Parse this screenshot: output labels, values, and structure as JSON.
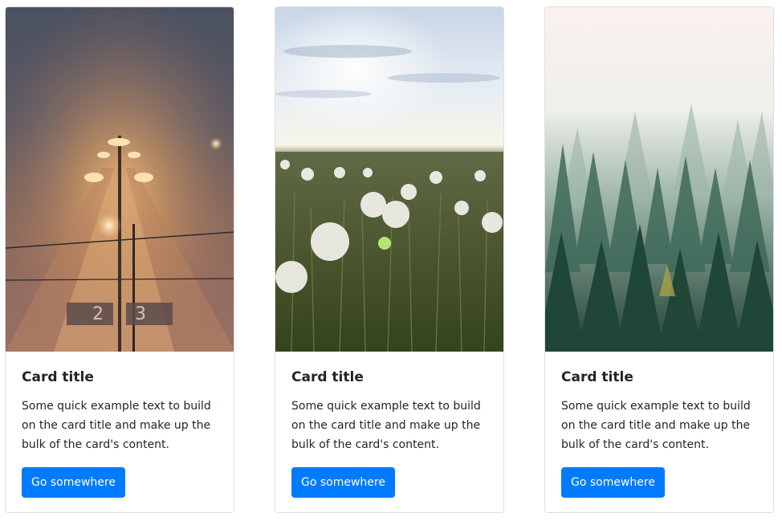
{
  "cards": [
    {
      "image_name": "foggy-station-image",
      "title": "Card title",
      "text": "Some quick example text to build on the card title and make up the bulk of the card's content.",
      "button_label": "Go somewhere",
      "platform_sign_left": "2",
      "platform_sign_right": "3"
    },
    {
      "image_name": "dandelion-field-image",
      "title": "Card title",
      "text": "Some quick example text to build on the card title and make up the bulk of the card's content.",
      "button_label": "Go somewhere"
    },
    {
      "image_name": "misty-forest-image",
      "title": "Card title",
      "text": "Some quick example text to build on the card title and make up the bulk of the card's content.",
      "button_label": "Go somewhere"
    }
  ],
  "colors": {
    "button_bg": "#007bff",
    "button_text": "#ffffff",
    "card_border": "#dfdfdf",
    "text": "#212529"
  }
}
